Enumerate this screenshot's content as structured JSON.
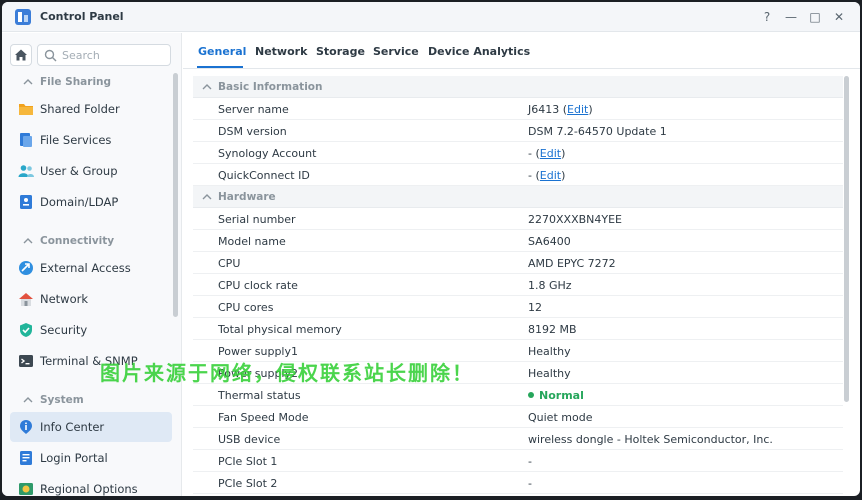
{
  "window": {
    "title": "Control Panel"
  },
  "title_buttons": {
    "help": "?",
    "minimize": "—",
    "maximize": "□",
    "close": "✕"
  },
  "search": {
    "placeholder": "Search"
  },
  "sidebar": {
    "sections": [
      {
        "label": "File Sharing",
        "items": [
          "Shared Folder",
          "File Services",
          "User & Group",
          "Domain/LDAP"
        ]
      },
      {
        "label": "Connectivity",
        "items": [
          "External Access",
          "Network",
          "Security",
          "Terminal & SNMP"
        ]
      },
      {
        "label": "System",
        "items": [
          "Info Center",
          "Login Portal",
          "Regional Options"
        ]
      }
    ],
    "active_item": "Info Center"
  },
  "tabs": [
    "General",
    "Network",
    "Storage",
    "Service",
    "Device Analytics"
  ],
  "active_tab": "General",
  "info": {
    "basic_label": "Basic Information",
    "hardware_label": "Hardware",
    "server_name": {
      "label": "Server name",
      "value": "J6413",
      "edit": "Edit"
    },
    "dsm_version": {
      "label": "DSM version",
      "value": "DSM 7.2-64570 Update 1"
    },
    "synology_account": {
      "label": "Synology Account",
      "value": "-",
      "edit": "Edit"
    },
    "quickconnect_id": {
      "label": "QuickConnect ID",
      "value": "-",
      "edit": "Edit"
    },
    "serial_number": {
      "label": "Serial number",
      "value": "2270XXXBN4YEE"
    },
    "model_name": {
      "label": "Model name",
      "value": "SA6400"
    },
    "cpu": {
      "label": "CPU",
      "value": "AMD EPYC 7272"
    },
    "cpu_clock": {
      "label": "CPU clock rate",
      "value": "1.8 GHz"
    },
    "cpu_cores": {
      "label": "CPU cores",
      "value": "12"
    },
    "memory": {
      "label": "Total physical memory",
      "value": "8192 MB"
    },
    "psu1": {
      "label": "Power supply1",
      "value": "Healthy"
    },
    "psu2": {
      "label": "Power supply2",
      "value": "Healthy"
    },
    "thermal": {
      "label": "Thermal status",
      "value": "Normal"
    },
    "fan": {
      "label": "Fan Speed Mode",
      "value": "Quiet mode"
    },
    "usb": {
      "label": "USB device",
      "value": "wireless dongle - Holtek Semiconductor, Inc."
    },
    "pcie1": {
      "label": "PCIe Slot 1",
      "value": "-"
    },
    "pcie2": {
      "label": "PCIe Slot 2",
      "value": "-"
    }
  },
  "watermark": "图片来源于网络，侵权联系站长删除！",
  "colors": {
    "accent": "#1a72d1",
    "ok": "#26a65b",
    "watermark": "#38d13a"
  }
}
